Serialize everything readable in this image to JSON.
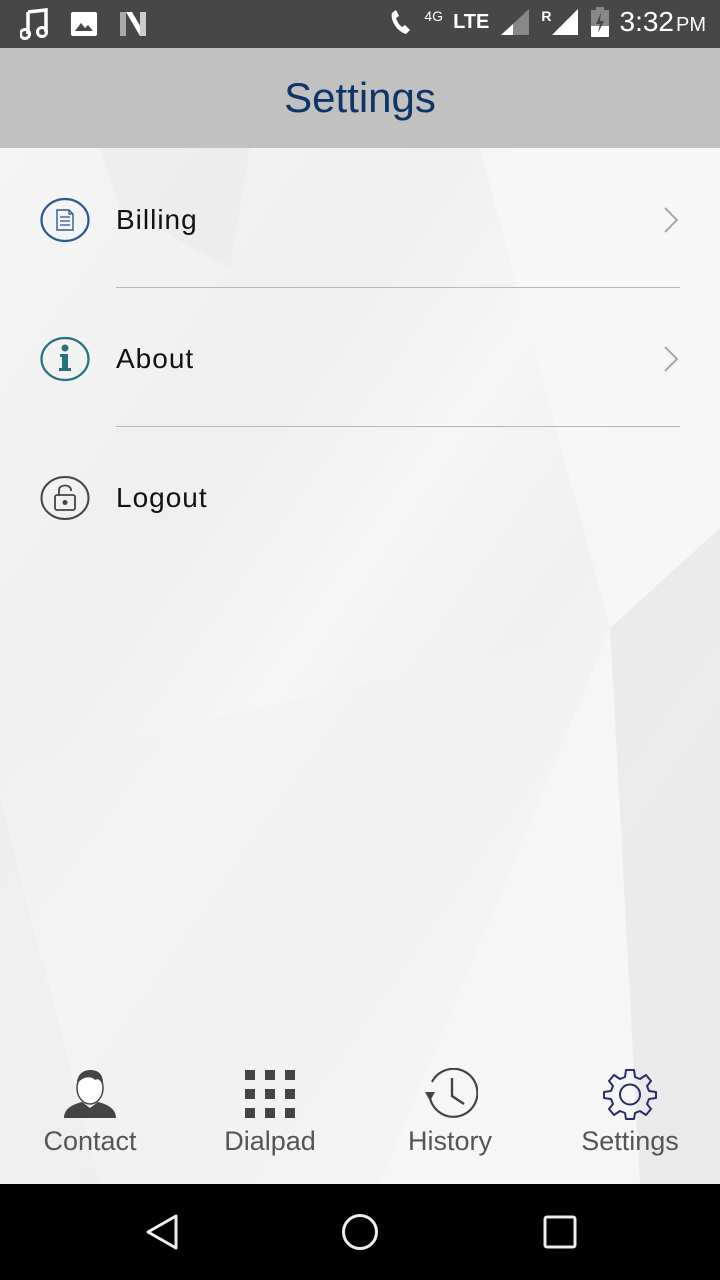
{
  "status_bar": {
    "icons_left": [
      "music-icon",
      "image-icon",
      "n-icon"
    ],
    "network_type": "4G",
    "lte_label": "LTE",
    "roaming_label": "R",
    "time": "3:32",
    "ampm": "PM"
  },
  "header": {
    "title": "Settings"
  },
  "menu": {
    "items": [
      {
        "label": "Billing",
        "icon": "document-icon",
        "has_chevron": true
      },
      {
        "label": "About",
        "icon": "info-icon",
        "has_chevron": true
      },
      {
        "label": "Logout",
        "icon": "unlock-icon",
        "has_chevron": false
      }
    ]
  },
  "bottom_nav": {
    "items": [
      {
        "label": "Contact",
        "icon": "person-icon"
      },
      {
        "label": "Dialpad",
        "icon": "dialpad-icon"
      },
      {
        "label": "History",
        "icon": "history-icon"
      },
      {
        "label": "Settings",
        "icon": "gear-icon",
        "active": true
      }
    ]
  },
  "colors": {
    "title": "#0f3466",
    "app_bar": "#c2c1c2",
    "status_bar": "#474747",
    "billing_icon": "#2f5a8f",
    "about_icon": "#26727c",
    "logout_icon": "#444444",
    "active_nav": "#2c2a6b"
  }
}
